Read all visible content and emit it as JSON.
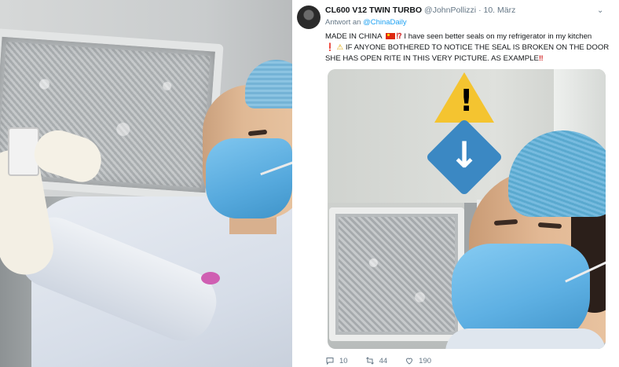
{
  "tweet": {
    "author_name": "CL600 V12 TWIN TURBO",
    "author_handle": "@JohnPollizzi",
    "separator": "·",
    "date": "10. März",
    "reply_prefix": "Antwort an",
    "reply_to": "@ChinaDaily",
    "text_1": "MADE IN CHINA",
    "text_2": "I have seen better seals on my refrigerator in my kitchen",
    "text_3": "IF ANYONE BOTHERED TO NOTICE THE SEAL IS BROKEN ON THE DOOR SHE HAS OPEN RITE IN THIS VERY PICTURE. AS EXAMPLE",
    "exclaim_question": "⁉",
    "double_exclaim": "‼",
    "single_exclaim": "❗",
    "warning_glyph": "⚠",
    "caret_glyph": "⌄",
    "warning_sign_glyph": "!",
    "down_arrow_glyph": "↓",
    "replies": "10",
    "retweets": "44",
    "likes": "190"
  },
  "icons": {
    "avatar": "avatar",
    "caret": "chevron-down-icon",
    "reply": "reply-icon",
    "retweet": "retweet-icon",
    "like": "heart-icon",
    "flag": "china-flag-icon",
    "warning": "warning-icon",
    "arrow": "arrow-down-icon"
  },
  "colors": {
    "link": "#1da1f2",
    "muted": "#657786",
    "text": "#14171a",
    "warning_yellow": "#f4c430",
    "arrow_blue": "#3b88c3",
    "mask_blue": "#5eb0e3"
  }
}
